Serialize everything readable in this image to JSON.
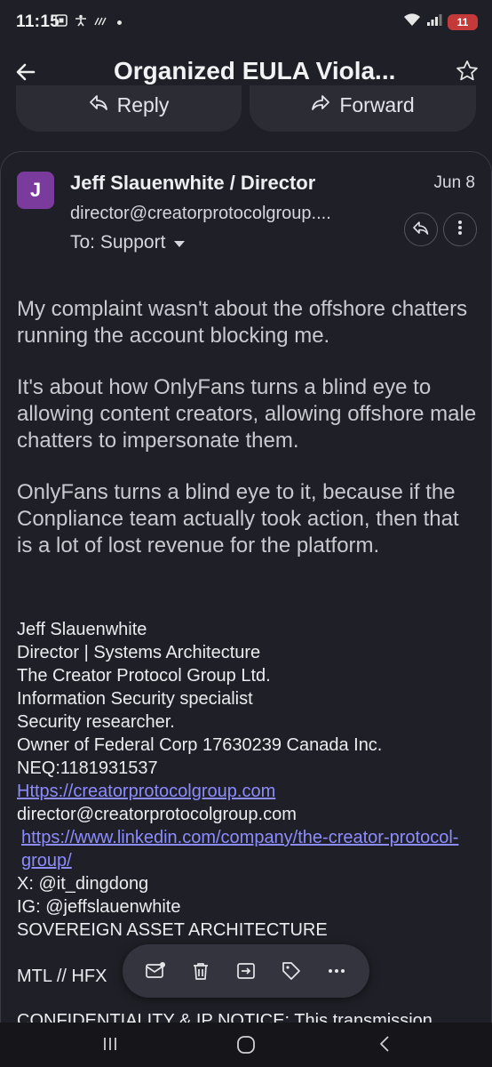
{
  "status_bar": {
    "time": "11:15",
    "battery": "11"
  },
  "app_bar": {
    "title": "Organized EULA Viola..."
  },
  "actions": {
    "reply_label": "Reply",
    "forward_label": "Forward"
  },
  "message": {
    "avatar_letter": "J",
    "sender": "Jeff Slauenwhite / Director",
    "date": "Jun 8",
    "address": "director@creatorprotocolgroup....",
    "to_label": "To: Support",
    "body": [
      "My complaint wasn't about the offshore chatters running the account blocking me.",
      "It's about how OnlyFans turns a blind eye to allowing content creators,  allowing offshore male chatters to impersonate them.",
      "OnlyFans turns a blind eye to it, because if the Conpliance team actually took action, then that is a lot of lost revenue for the platform."
    ],
    "signature": {
      "name": "Jeff Slauenwhite",
      "role": "Director | Systems Architecture",
      "company": "The Creator Protocol Group Ltd.",
      "line1": "Information Security specialist",
      "line2": "Security researcher.",
      "line3": "Owner of Federal Corp 17630239 Canada Inc.",
      "neq": "NEQ:1181931537",
      "website": "Https://creatorprotocolgroup.com",
      "email": "director@creatorprotocolgroup.com",
      "linkedin": "https://www.linkedin.com/company/the-creator-protocol-group/",
      "x": "X: @it_dingdong",
      "ig": "IG: @jeffslauenwhite",
      "tagline": "SOVEREIGN ASSET ARCHITECTURE",
      "location": "MTL // HFX"
    },
    "confidentiality_partial": "CONFIDENTIALITY & IP NOTICE: This transmission"
  },
  "colors": {
    "background": "#1f1f27",
    "avatar": "#7b3b9c",
    "link": "#8c8cff",
    "battery": "#c43a3a"
  }
}
